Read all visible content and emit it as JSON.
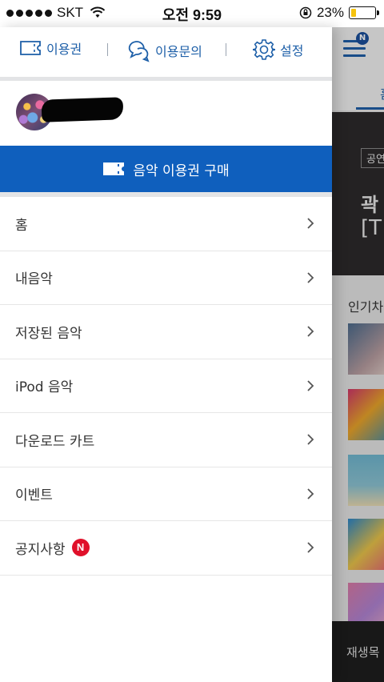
{
  "status_bar": {
    "carrier": "SKT",
    "time": "오전 9:59",
    "battery_percent": "23%",
    "battery_level": 0.23
  },
  "drawer": {
    "top_links": [
      {
        "label": "이용권",
        "icon": "ticket-icon"
      },
      {
        "label": "이용문의",
        "icon": "chat-bubbles-icon"
      },
      {
        "label": "설정",
        "icon": "gear-icon"
      }
    ],
    "buy_button": {
      "label": "음악 이용권 구매",
      "icon": "ticket-icon"
    },
    "menu": [
      {
        "label": "홈"
      },
      {
        "label": "내음악"
      },
      {
        "label": "저장된 음악"
      },
      {
        "label": "iPod 음악"
      },
      {
        "label": "다운로드 카트"
      },
      {
        "label": "이벤트"
      },
      {
        "label": "공지사항",
        "badge": "N"
      }
    ]
  },
  "background_app": {
    "menu_badge": "N",
    "tab_label": "홈",
    "banner_chip": "공연",
    "banner_title": "곽",
    "banner_bracket": "[T",
    "section_title": "인기차",
    "player_label": "재생목"
  },
  "colors": {
    "accent": "#0f5fbd",
    "link": "#1d5fa8",
    "badge_red": "#e0102a",
    "battery_yellow": "#f5c20d"
  }
}
